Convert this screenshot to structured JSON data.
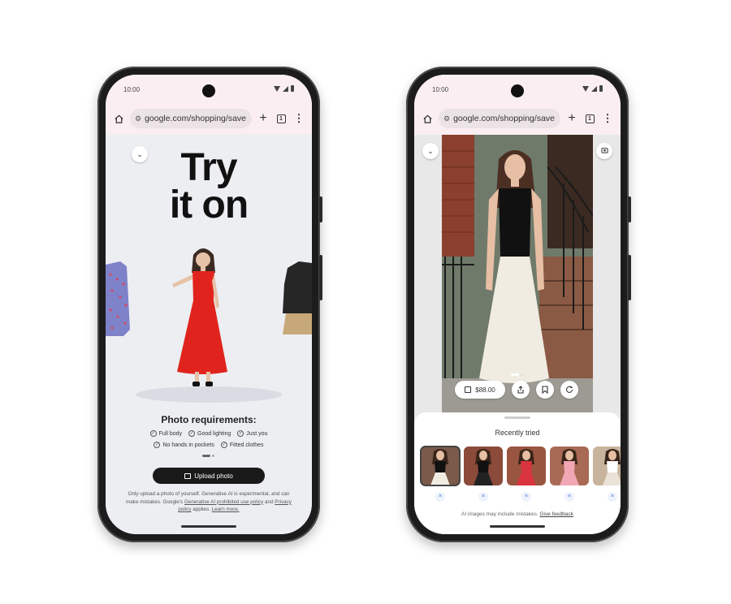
{
  "phone_left": {
    "status": {
      "time": "10:00"
    },
    "browser": {
      "url": "google.com/shopping/save",
      "tab_count": "1",
      "new_tab": "+",
      "menu": "⋮"
    },
    "hero_title_line1": "Try",
    "hero_title_line2": "it on",
    "requirements": {
      "title": "Photo requirements:",
      "row1": [
        "Full body",
        "Good lighting",
        "Just you"
      ],
      "row2": [
        "No hands in pockets",
        "Fitted clothes"
      ]
    },
    "upload_label": "Upload photo",
    "disclaimer": {
      "text_before": "Only upload a photo of yourself. Generative AI is experimental, and can make mistakes. Google's ",
      "link_policy": "Generative AI prohibited use policy",
      "and": " and ",
      "link_privacy": "Privacy policy",
      "applies": " applies. ",
      "link_learn": "Learn more."
    }
  },
  "phone_right": {
    "status": {
      "time": "10:00"
    },
    "browser": {
      "url": "google.com/shopping/save",
      "tab_count": "1",
      "new_tab": "+",
      "menu": "⋮"
    },
    "price": "$88.00",
    "recently_tried": "Recently tried",
    "thumbnails": [
      {
        "top_color": "#111111",
        "bottom_color": "#f1ece2",
        "selected": true
      },
      {
        "top_color": "#111111",
        "bottom_color": "#222222",
        "selected": false
      },
      {
        "top_color": "#d9333d",
        "bottom_color": "#d9333d",
        "selected": false
      },
      {
        "top_color": "#f2a7b4",
        "bottom_color": "#f2a7b4",
        "selected": false
      },
      {
        "top_color": "#ffffff",
        "bottom_color": "#e9e2d6",
        "selected": false
      }
    ],
    "remove_symbol": "×",
    "ai_note": "AI images may include mistakes.",
    "feedback_link": "Give feedback"
  },
  "icons": {
    "home": "home-icon",
    "tune": "tune-icon",
    "collapse": "chevron-down-icon",
    "share": "share-icon",
    "bookmark": "bookmark-icon",
    "refresh": "refresh-icon",
    "camera": "add-photo-icon",
    "bag": "shopping-bag-icon"
  },
  "colors": {
    "status_bg": "#fbeef2",
    "hero_bg": "#eceef2",
    "dress_red": "#e0241d",
    "button_dark": "#1a1a1a",
    "link_blue": "#3b6fd4"
  }
}
